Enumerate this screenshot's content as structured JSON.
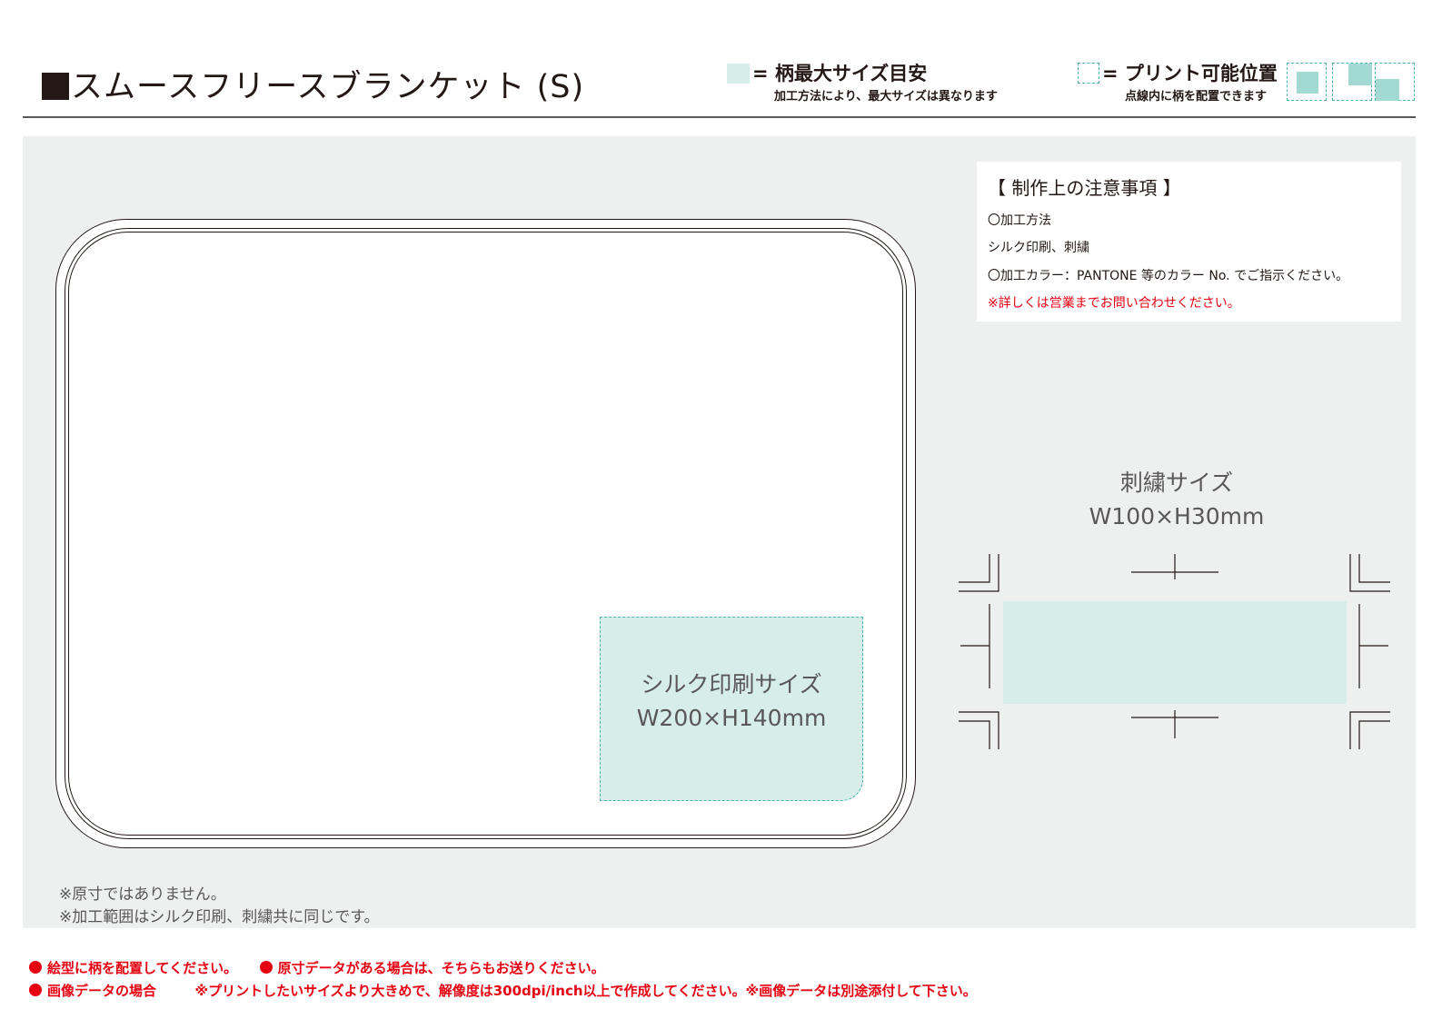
{
  "header": {
    "title": "スムースフリースブランケット (S)",
    "legend_max": "= 柄最大サイズ目安",
    "legend_max_sub": "加工方法により、最大サイズは異なります",
    "legend_print": "= プリント可能位置",
    "legend_print_sub": "点線内に柄を配置できます"
  },
  "canvas": {
    "silk_label": "シルク印刷サイズ",
    "silk_size": "W200×H140mm",
    "embroidery_label": "刺繍サイズ",
    "embroidery_size": "W100×H30mm"
  },
  "notes": {
    "title": "【 制作上の注意事項 】",
    "line1": "〇加工方法",
    "line2": "シルク印刷、刺繍",
    "line3": "〇加工カラー：PANTONE 等のカラー No. でご指示ください。",
    "line4": "※詳しくは営業までお問い合わせください。"
  },
  "footnotes": {
    "line1": "※原寸ではありません。",
    "line2": "※加工範囲はシルク印刷、刺繍共に同じです。"
  },
  "instructions": {
    "item1": "絵型に柄を配置してください。",
    "item2": "原寸データがある場合は、そちらもお送りください。",
    "item3": "画像データの場合",
    "item3_detail": "※プリントしたいサイズより大きめで、解像度は300dpi/inch以上で作成してください。※画像データは別途添付して下さい。"
  },
  "colors": {
    "max_size_fill": "#d7ede9",
    "print_area_dash": "#4bb3ad",
    "warning_red": "#e60012",
    "panel_bg": "#eeefef"
  }
}
